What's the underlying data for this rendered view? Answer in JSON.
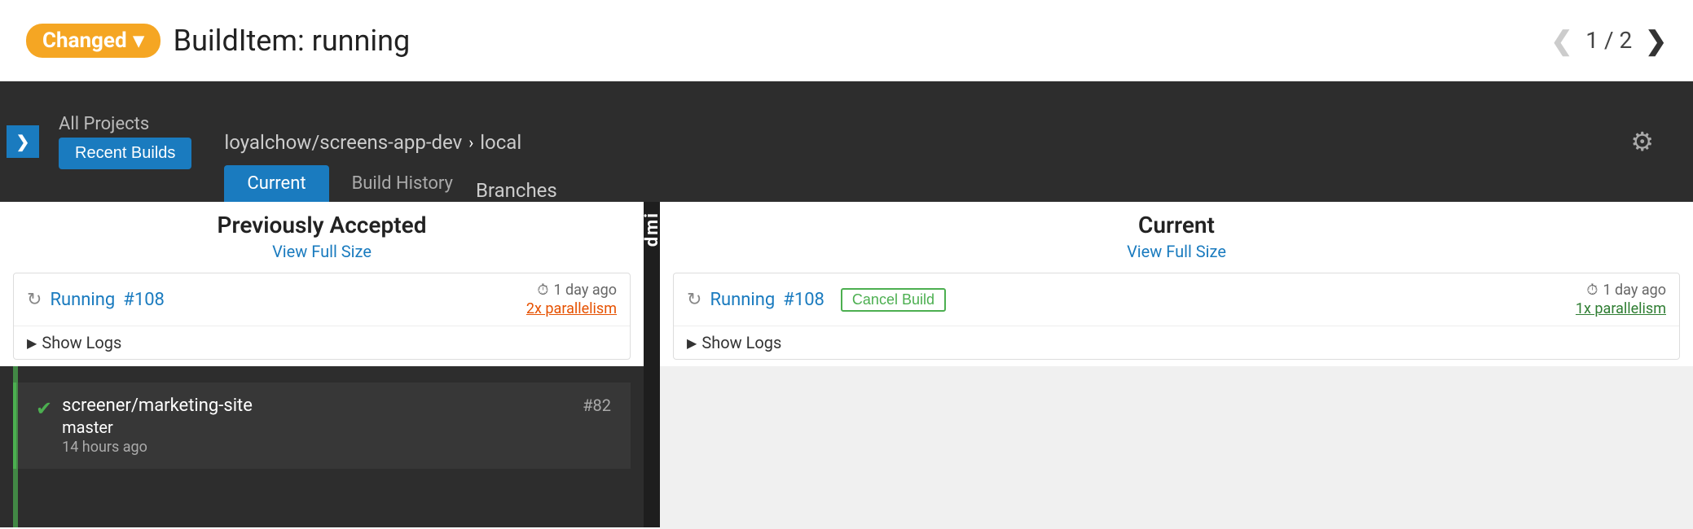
{
  "header": {
    "changed_label": "Changed",
    "dropdown_arrow": "▾",
    "build_title": "BuildItem: running",
    "pagination": {
      "current": "1",
      "total": "2",
      "separator": "/",
      "display": "1 / 2"
    },
    "prev_arrow": "❮",
    "next_arrow": "❯"
  },
  "dark_section": {
    "toggle_icon": "❯",
    "breadcrumb": "All Projects",
    "project_button": "Recent Builds",
    "project_path": "loyalchow/screens-app-dev",
    "project_path_arrow": "›",
    "local": "local",
    "tabs": [
      {
        "label": "Current",
        "active": true
      },
      {
        "label": "Build History",
        "active": false
      }
    ],
    "branches_label": "Branches",
    "gear_icon": "⚙"
  },
  "previously_accepted": {
    "title": "Previously Accepted",
    "view_full_size": "View Full Size",
    "build": {
      "running_icon": "↻",
      "label": "Running",
      "number": "#108",
      "time_ago": "1 day ago",
      "clock_icon": "⏱",
      "parallelism": "2x parallelism"
    },
    "show_logs": "Show Logs",
    "project_item": {
      "name": "screener/marketing-site",
      "branch": "master",
      "time": "14 hours ago",
      "number": "#82"
    }
  },
  "current": {
    "title": "Current",
    "view_full_size": "View Full Size",
    "build": {
      "running_icon": "↻",
      "label": "Running",
      "number": "#108",
      "cancel_build": "Cancel Build",
      "time_ago": "1 day ago",
      "clock_icon": "⏱",
      "parallelism": "1x parallelism"
    },
    "show_logs": "Show Logs"
  },
  "divider": {
    "text": "dmi"
  }
}
